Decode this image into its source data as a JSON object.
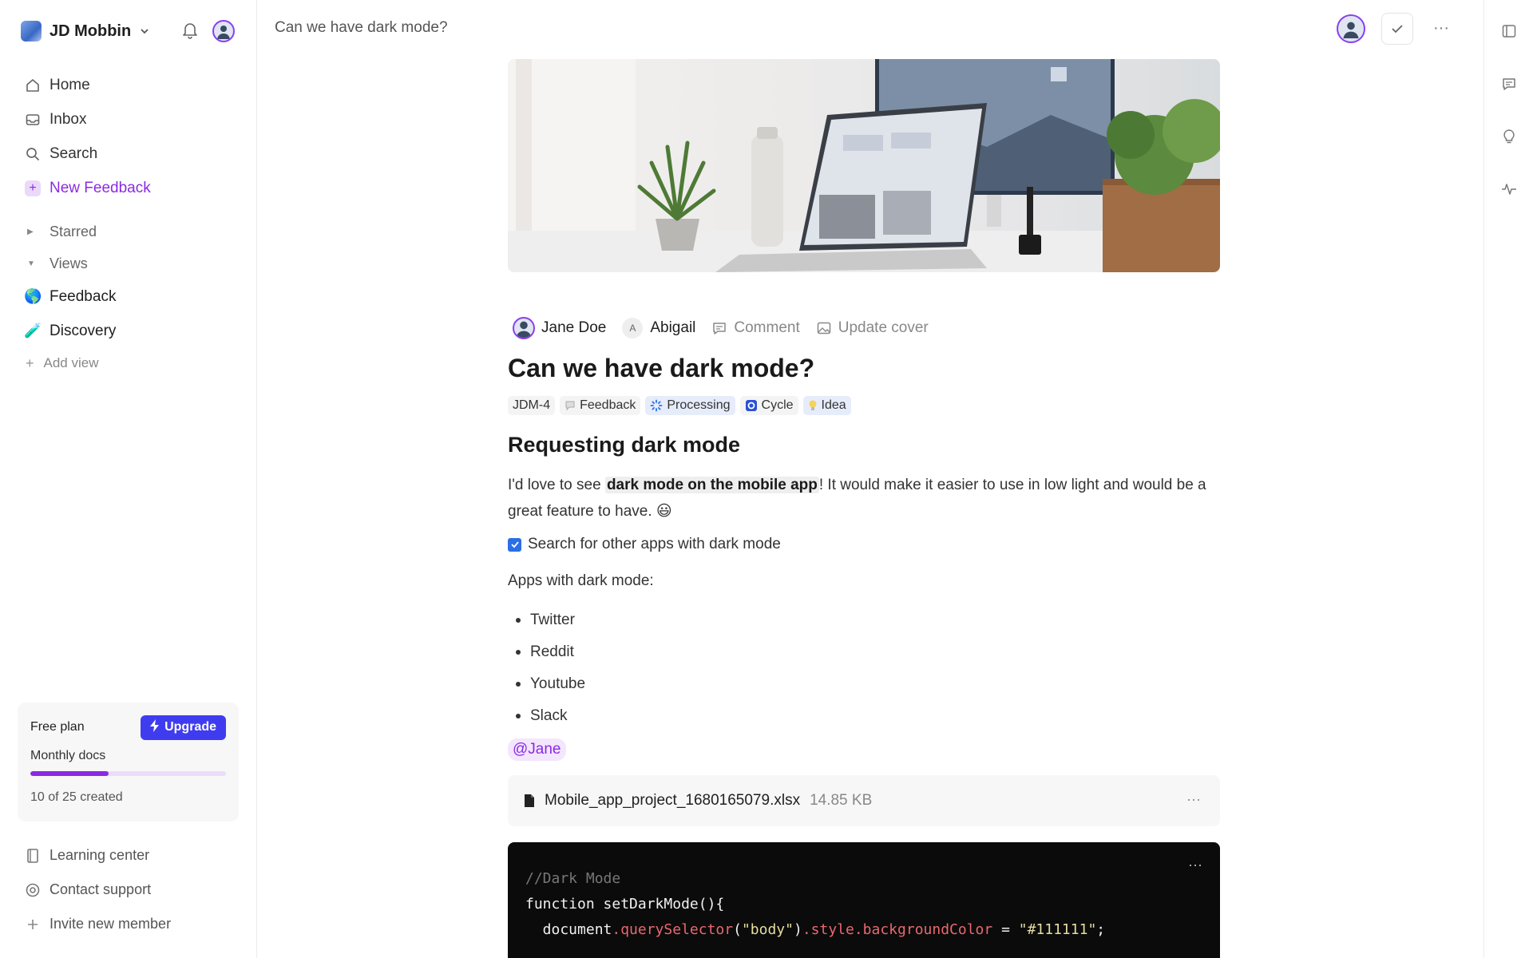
{
  "workspace": {
    "name": "JD Mobbin"
  },
  "nav": [
    {
      "label": "Home",
      "icon": "home-icon"
    },
    {
      "label": "Inbox",
      "icon": "inbox-icon"
    },
    {
      "label": "Search",
      "icon": "search-icon"
    }
  ],
  "new_feedback": "New Feedback",
  "sections": {
    "starred": "Starred",
    "views": "Views"
  },
  "views": [
    {
      "label": "Feedback",
      "emoji": "🌎"
    },
    {
      "label": "Discovery",
      "emoji": "🧪"
    }
  ],
  "add_view": "Add view",
  "plan": {
    "title": "Free plan",
    "upgrade": "Upgrade",
    "metric": "Monthly docs",
    "count_text": "10 of 25 created",
    "used": 10,
    "total": 25
  },
  "bottom_nav": [
    {
      "label": "Learning center",
      "icon": "book-icon"
    },
    {
      "label": "Contact support",
      "icon": "lifebuoy-icon"
    },
    {
      "label": "Invite new member",
      "icon": "plus-icon"
    }
  ],
  "breadcrumb": "Can we have dark mode?",
  "doc": {
    "meta": {
      "author": "Jane Doe",
      "assignee_initial": "A",
      "assignee": "Abigail",
      "comment": "Comment",
      "update_cover": "Update cover"
    },
    "title": "Can we have dark mode?",
    "tags": [
      {
        "label": "JDM-4"
      },
      {
        "label": "Feedback"
      },
      {
        "label": "Processing"
      },
      {
        "label": "Cycle"
      },
      {
        "label": "Idea"
      }
    ],
    "heading": "Requesting dark mode",
    "para_before": "I'd love to see ",
    "para_highlight": "dark mode on the mobile app",
    "para_after": "! It would make it easier to use in low light and would be a great feature to have. 😃",
    "todo": "Search for other apps with dark mode",
    "list_label": "Apps with dark mode:",
    "list": [
      "Twitter",
      "Reddit",
      "Youtube",
      "Slack"
    ],
    "mention": "@Jane",
    "file": {
      "name": "Mobile_app_project_1680165079.xlsx",
      "size": "14.85 KB"
    },
    "code": {
      "comment": "//Dark Mode",
      "line1": "function setDarkMode(){",
      "l3_a": "  document",
      "l3_b": ".querySelector",
      "l3_c": "(",
      "l3_d": "\"body\"",
      "l3_e": ")",
      "l3_f": ".style.backgroundColor",
      "l3_g": " = ",
      "l3_h": "\"#111111\"",
      "l3_i": ";"
    }
  },
  "colors": {
    "accent": "#8a2be2",
    "upgrade": "#3f3cf0",
    "checkbox": "#2b6ee6"
  }
}
